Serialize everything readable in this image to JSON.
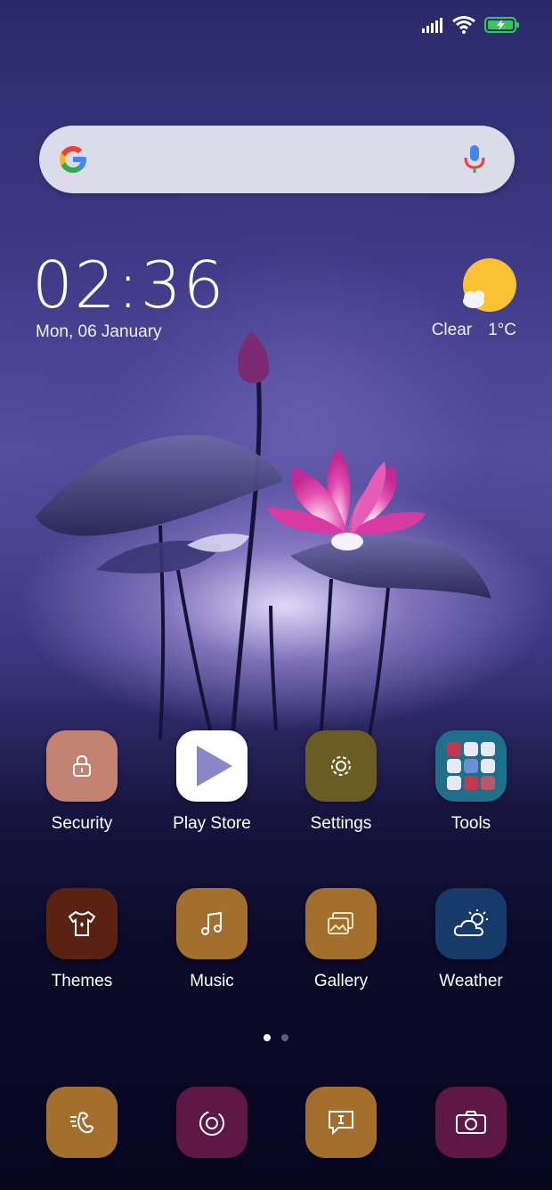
{
  "status_bar": {
    "icons": [
      "signal-icon",
      "wifi-icon",
      "battery-charging-icon"
    ],
    "battery_color": "#34c759"
  },
  "search": {
    "placeholder": "",
    "icons": [
      "google-g-icon",
      "microphone-icon"
    ]
  },
  "clock": {
    "time": "02:36",
    "date": "Mon, 06 January"
  },
  "weather_widget": {
    "condition": "Clear",
    "temperature": "1°C",
    "icon": "sun-cloud-icon",
    "sun_color": "#f9c233"
  },
  "apps": [
    {
      "label": "Security",
      "icon": "lock-icon",
      "color": "#c48272"
    },
    {
      "label": "Play Store",
      "icon": "play-triangle-icon",
      "color": "#ffffff"
    },
    {
      "label": "Settings",
      "icon": "gear-icon",
      "color": "#6a5c22"
    },
    {
      "label": "Tools",
      "icon": "folder-grid-icon",
      "color": "#1f6e8a"
    },
    {
      "label": "Themes",
      "icon": "tshirt-icon",
      "color": "#5a2210"
    },
    {
      "label": "Music",
      "icon": "music-note-icon",
      "color": "#a2702c"
    },
    {
      "label": "Gallery",
      "icon": "photos-icon",
      "color": "#a2702c"
    },
    {
      "label": "Weather",
      "icon": "cloud-sun-icon",
      "color": "#163a6a"
    }
  ],
  "page_indicator": {
    "pages": 2,
    "active": 1
  },
  "dock": [
    {
      "icon": "phone-icon",
      "color": "#a2702c"
    },
    {
      "icon": "browser-icon",
      "color": "#5e1848"
    },
    {
      "icon": "message-icon",
      "color": "#a2702c"
    },
    {
      "icon": "camera-icon",
      "color": "#5e1848"
    }
  ]
}
